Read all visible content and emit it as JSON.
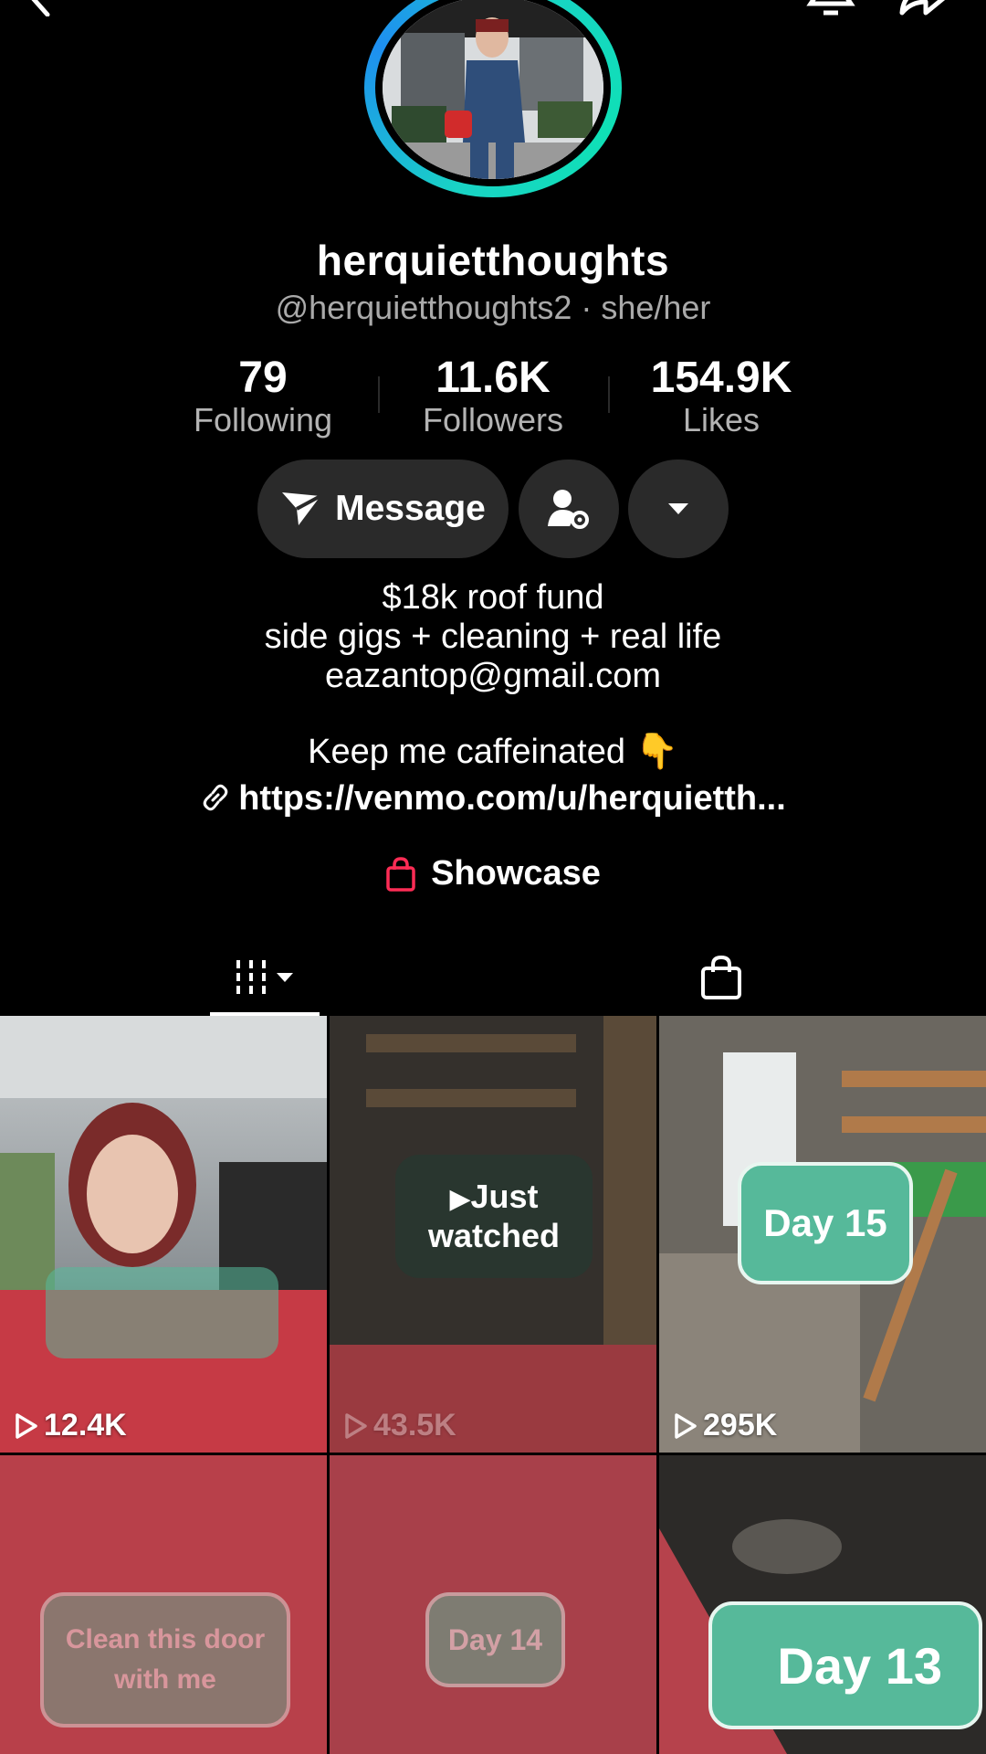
{
  "profile": {
    "display_name": "herquietthoughts",
    "handle_line": "@herquietthoughts2 · she/her"
  },
  "stats": [
    {
      "value": "79",
      "label": "Following"
    },
    {
      "value": "11.6K",
      "label": "Followers"
    },
    {
      "value": "154.9K",
      "label": "Likes"
    }
  ],
  "actions": {
    "message_label": "Message"
  },
  "bio": {
    "line1": "$18k roof fund",
    "line2": "side gigs + cleaning + real life",
    "line3": "eazantop@gmail.com",
    "line4": "Keep me caffeinated 👇",
    "link": "https://venmo.com/u/herquietth..."
  },
  "showcase_label": "Showcase",
  "videos": [
    {
      "views": "12.4K",
      "overlay": ""
    },
    {
      "views": "43.5K",
      "overlay_top": "Just",
      "overlay_bottom": "watched"
    },
    {
      "views": "295K",
      "overlay": "Day 15"
    },
    {
      "views": "",
      "overlay": "Clean this door with me"
    },
    {
      "views": "",
      "overlay": "Day 14"
    },
    {
      "views": "",
      "overlay": "Day 13"
    }
  ],
  "colors": {
    "background": "#000000",
    "button_bg": "#2a2a2a",
    "ring": "#19d3c5",
    "bubble": "#56b99a",
    "showcase_icon": "#fe2c55"
  },
  "icons": [
    "back-icon",
    "bell-icon",
    "share-icon",
    "send-icon",
    "add-friend-icon",
    "chevron-down-icon",
    "link-icon",
    "shopping-bag-icon",
    "grid-icon",
    "play-icon"
  ]
}
